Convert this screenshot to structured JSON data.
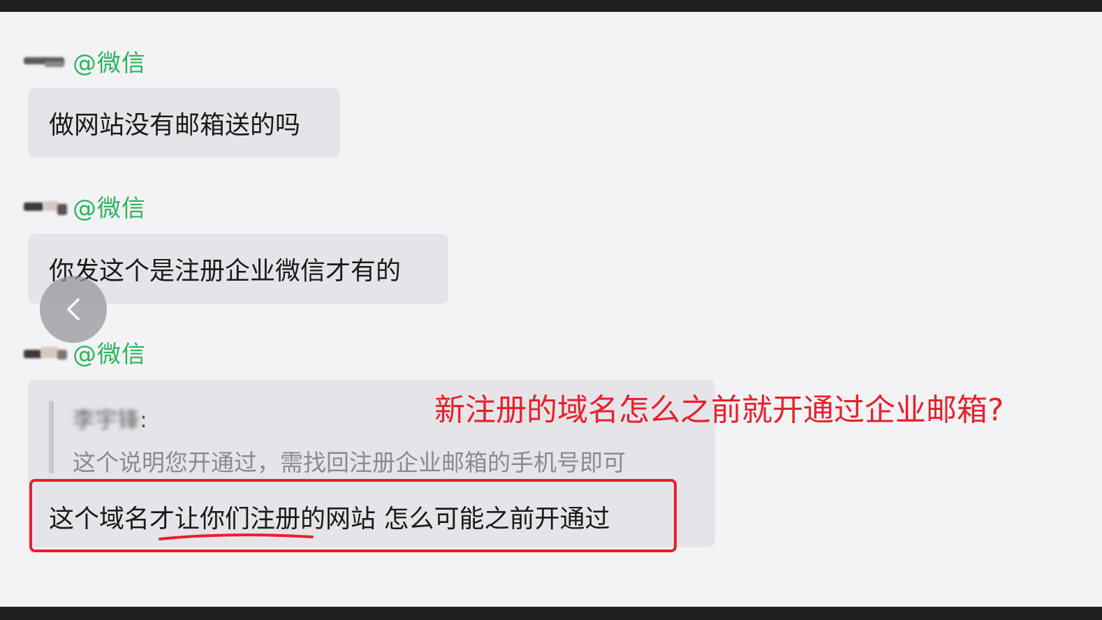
{
  "messages": [
    {
      "sender_suffix": "@微信",
      "text": "做网站没有邮箱送的吗"
    },
    {
      "sender_suffix": "@微信",
      "text": "你发这个是注册企业微信才有的"
    },
    {
      "sender_suffix": "@微信",
      "quote": {
        "name": "李宇锋",
        "colon": ":",
        "text": "这个说明您开通过，需找回注册企业邮箱的手机号即可"
      },
      "text": "这个域名才让你们注册的网站 怎么可能之前开通过"
    }
  ],
  "annotation": {
    "text": "新注册的域名怎么之前就开通过企业邮箱?",
    "color": "#e8202a"
  },
  "colors": {
    "wechat_green": "#2bb55a",
    "bubble_bg": "#e5e5e9",
    "page_bg": "#f3f3f5"
  },
  "icons": {
    "back": "chevron-left-icon"
  }
}
